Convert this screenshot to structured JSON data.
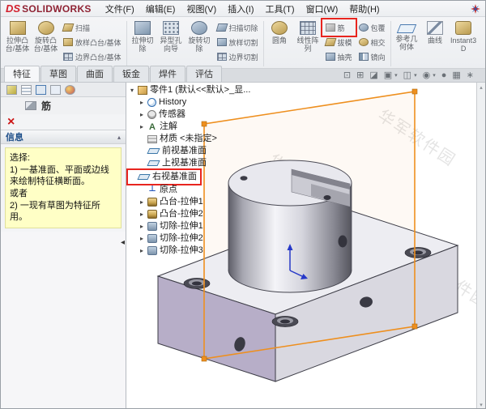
{
  "window": {
    "logo_mark": "DS",
    "logo_name": "SOLIDWORKS"
  },
  "menu": {
    "items": [
      "文件(F)",
      "编辑(E)",
      "视图(V)",
      "插入(I)",
      "工具(T)",
      "窗口(W)",
      "帮助(H)"
    ]
  },
  "ribbon": {
    "extrude_boss": "拉伸凸台/基体",
    "revolve_boss": "旋转凸台/基体",
    "sweep": "扫描",
    "loft_boss": "放样凸台/基体",
    "boundary_boss": "边界凸台/基体",
    "extrude_cut": "拉伸切除",
    "hole_wizard": "异型孔向导",
    "revolve_cut": "旋转切除",
    "sweep_cut": "扫描切除",
    "loft_cut": "放样切割",
    "boundary_cut": "边界切割",
    "fillet": "圆角",
    "linear_pattern": "线性阵列",
    "rib": "筋",
    "draft": "拔模",
    "shell": "抽壳",
    "wrap": "包覆",
    "intersect": "相交",
    "mirror": "镜向",
    "reference_geometry": "参考几何体",
    "curves": "曲线",
    "instant3d": "Instant3D"
  },
  "tabs": {
    "items": [
      "特征",
      "草图",
      "曲面",
      "钣金",
      "焊件",
      "评估"
    ]
  },
  "hud": {
    "icons": [
      "⊡",
      "⊞",
      "◪",
      "▣",
      "◫",
      "◉",
      "●",
      "▦",
      "∗"
    ],
    "caret": "▾"
  },
  "property_panel": {
    "title": "筋",
    "cancel_icon": "×",
    "section_header": "信息",
    "section_chevron": "▴",
    "collapse_icon": "◂",
    "message_lines": [
      "选择:",
      "1) 一基准面、平面或边线来绘制特征横断面。",
      "或者",
      "2) 一现有草图为特征所用。"
    ]
  },
  "feature_tree": {
    "root": "零件1 (默认<<默认>_显...",
    "items": [
      "History",
      "传感器",
      "注解",
      "材质 <未指定>",
      "前视基准面",
      "上视基准面",
      "右视基准面",
      "原点",
      "凸台-拉伸1",
      "凸台-拉伸2",
      "切除-拉伸1",
      "切除-拉伸2",
      "切除-拉伸3"
    ],
    "expander_collapsed": "▸",
    "expander_expanded": "▾",
    "icons": {
      "annotations": "A",
      "origin": "⊥"
    }
  },
  "scrollbar": {
    "up": "▴",
    "down": "▾"
  },
  "watermark": {
    "text": "华军软件园"
  },
  "colors": {
    "highlight_red": "#e8251f",
    "plane_orange": "#ee8f1e",
    "message_yellow": "#ffffc6"
  }
}
